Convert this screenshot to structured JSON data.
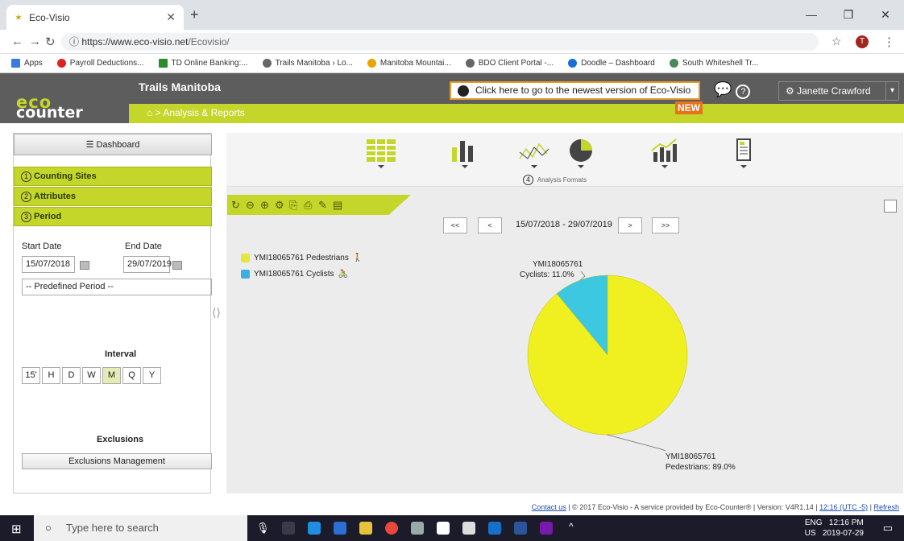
{
  "browser": {
    "tab_title": "Eco-Visio",
    "url_base": "https://www.eco-visio.net",
    "url_path": "/Ecovisio/",
    "bookmarks": [
      "Apps",
      "Payroll Deductions...",
      "TD Online Banking:...",
      "Trails Manitoba › Lo...",
      "Manitoba Mountai...",
      "BDO Client Portal -...",
      "Doodle – Dashboard",
      "South Whiteshell Tr..."
    ],
    "profile_initial": "T"
  },
  "header": {
    "logo_top": "eco",
    "logo_bottom": "counter",
    "site_name": "Trails Manitoba",
    "breadcrumb": "> Analysis & Reports",
    "promo": "Click here to go to the newest version of Eco-Visio",
    "promo_badge": "NEW",
    "user": "Janette Crawford"
  },
  "left": {
    "dashboard": "Dashboard",
    "sections": [
      {
        "num": "1",
        "label": "Counting Sites"
      },
      {
        "num": "2",
        "label": "Attributes"
      },
      {
        "num": "3",
        "label": "Period"
      }
    ],
    "start_label": "Start Date",
    "end_label": "End Date",
    "start_date": "15/07/2018",
    "end_date": "29/07/2019",
    "predefined": "-- Predefined Period --",
    "interval_label": "Interval",
    "intervals": [
      "15'",
      "H",
      "D",
      "W",
      "M",
      "Q",
      "Y"
    ],
    "active_interval": "M",
    "exclusions_label": "Exclusions",
    "exclusions_btn": "Exclusions Management"
  },
  "analysis": {
    "formats_num": "4",
    "formats_label": "Analysis Formats",
    "date_range": "15/07/2018 - 29/07/2019",
    "nav": [
      "<<",
      "<",
      ">",
      ">>"
    ]
  },
  "chart_data": {
    "type": "pie",
    "series": [
      {
        "name": "YMI18065761 Pedestrians",
        "value": 89.0,
        "color": "#f0f020",
        "label1": "YMI18065761",
        "label2": "Pedestrians: 89.0%"
      },
      {
        "name": "YMI18065761 Cyclists",
        "value": 11.0,
        "color": "#3bc8e0",
        "label1": "YMI18065761",
        "label2": "Cyclists: 11.0%"
      }
    ]
  },
  "footer": {
    "contact": "Contact us",
    "copyright": "| © 2017 Eco-Visio - A service provided by Eco-Counter® | Version: V4R1.14 |",
    "time": "12:16 (UTC -5)",
    "refresh": "Refresh"
  },
  "taskbar": {
    "search": "Type here to search",
    "lang1": "ENG",
    "lang2": "US",
    "time": "12:16 PM",
    "date": "2019-07-29"
  }
}
